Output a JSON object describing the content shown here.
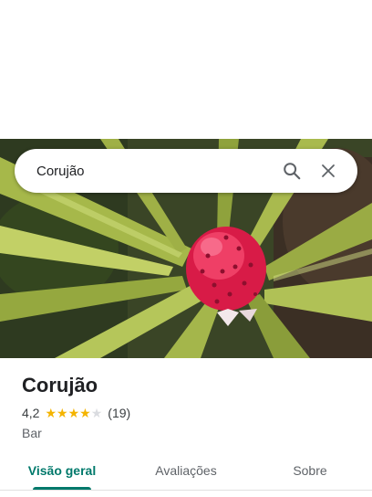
{
  "search": {
    "value": "Corujão",
    "search_icon": "search-icon",
    "close_icon": "close-icon"
  },
  "place": {
    "name": "Corujão",
    "rating": "4,2",
    "rating_fraction": 0.84,
    "review_count": "(19)",
    "category": "Bar"
  },
  "tabs": [
    {
      "label": "Visão geral",
      "active": true
    },
    {
      "label": "Avaliações",
      "active": false
    },
    {
      "label": "Sobre",
      "active": false
    }
  ],
  "colors": {
    "accent": "#00796b",
    "star": "#f4b400",
    "star_off": "#dadce0"
  }
}
